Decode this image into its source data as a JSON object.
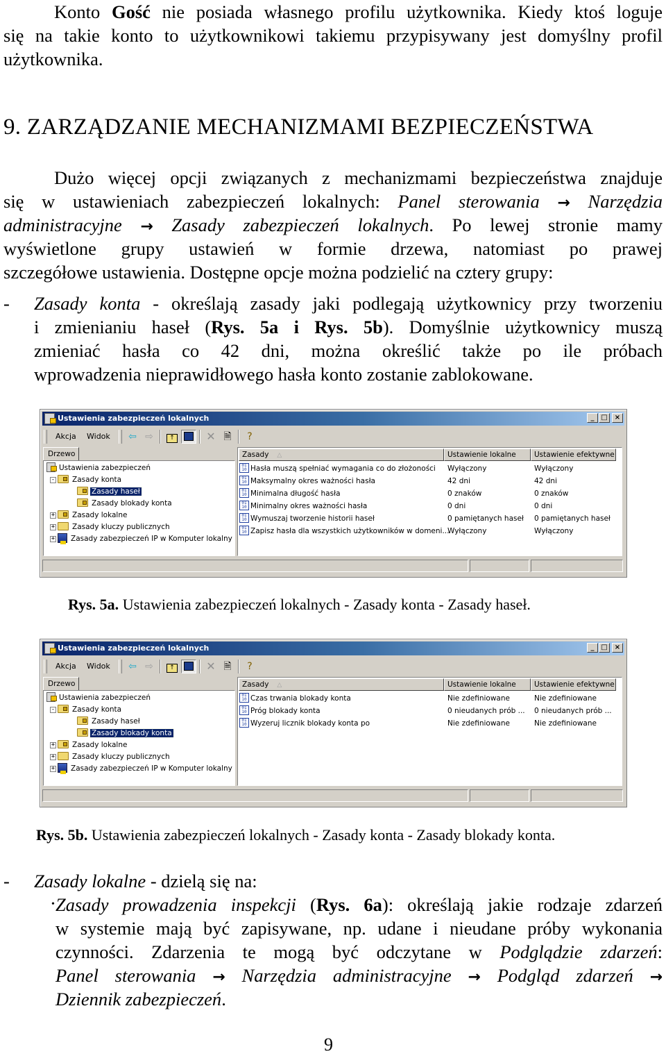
{
  "intro": {
    "line1_pre": "Konto ",
    "line1_bold": "Gość",
    "line1_post": " nie posiada własnego profilu użytkownika. Kiedy ktoś loguje",
    "line2": "się na takie konto to użytkownikowi takiemu przypisywany jest domyślny profil",
    "line3": "użytkownika."
  },
  "heading": "9. ZARZĄDZANIE MECHANIZMAMI BEZPIECZEŃSTWA",
  "para1": {
    "l1": "Dużo więcej opcji związanych z mechanizmami bezpieczeństwa znajduje",
    "l2_pre": "się w ustawieniach zabezpieczeń lokalnych: ",
    "l2_it1": "Panel sterowania",
    "l2_it2": "Narzędzia",
    "l3_it1": "administracyjne",
    "l3_it2": "Zasady zabezpieczeń lokalnych",
    "l3_post": ". Po lewej stronie mamy",
    "l4": "wyświetlone grupy ustawień w formie drzewa, natomiast po prawej",
    "l5": "szczegółowe ustawienia. Dostępne opcje można podzielić na cztery grupy:",
    "arrow": "→"
  },
  "bullet1": {
    "dash": "-",
    "l1_it": "Zasady konta",
    "l1_post": " - określają zasady jaki podlegają użytkownicy przy tworzeniu",
    "l2_pre": "i zmienianiu haseł (",
    "l2_b1": "Rys. 5a",
    "l2_mid": " i ",
    "l2_b2": "Rys. 5b",
    "l2_post": "). Domyślnie użytkownicy muszą",
    "l3": "zmieniać hasła co 42 dni, można określić także po ile próbach",
    "l4": "wprowadzenia nieprawidłowego hasła konto zostanie zablokowane."
  },
  "window": {
    "title": "Ustawienia zabezpieczeń lokalnych",
    "controls": {
      "minimize": "_",
      "maximize": "□",
      "close": "×"
    },
    "menu": {
      "action": "Akcja",
      "view": "Widok"
    },
    "toolbar_icons": [
      "back-arrow",
      "forward-arrow",
      "up-folder",
      "show-hide-tree",
      "delete",
      "export-list",
      "help"
    ],
    "tree_tab": "Drzewo",
    "tree": [
      {
        "label": "Ustawienia zabezpieczeń",
        "level": 0,
        "expander": "",
        "icon": "security-settings"
      },
      {
        "label": "Zasady konta",
        "level": 1,
        "expander": "-",
        "icon": "locked-folder"
      },
      {
        "label": "Zasady haseł",
        "level": 2,
        "expander": "",
        "icon": "locked-folder"
      },
      {
        "label": "Zasady blokady konta",
        "level": 2,
        "expander": "",
        "icon": "locked-folder"
      },
      {
        "label": "Zasady lokalne",
        "level": 1,
        "expander": "+",
        "icon": "locked-folder"
      },
      {
        "label": "Zasady kluczy publicznych",
        "level": 1,
        "expander": "+",
        "icon": "folder"
      },
      {
        "label": "Zasady zabezpieczeń IP w Komputer lokalny",
        "level": 1,
        "expander": "+",
        "icon": "computer-ip"
      }
    ],
    "columns": {
      "policy": "Zasady",
      "local": "Ustawienie lokalne",
      "effective": "Ustawienie efektywne"
    }
  },
  "fig5a": {
    "selected_tree_index": 2,
    "rows": [
      {
        "policy": "Hasła muszą spełniać wymagania co do złożoności",
        "local": "Wyłączony",
        "effective": "Wyłączony"
      },
      {
        "policy": "Maksymalny okres ważności hasła",
        "local": "42 dni",
        "effective": "42 dni"
      },
      {
        "policy": "Minimalna długość hasła",
        "local": "0 znaków",
        "effective": "0 znaków"
      },
      {
        "policy": "Minimalny okres ważności hasła",
        "local": "0 dni",
        "effective": "0 dni"
      },
      {
        "policy": "Wymuszaj tworzenie historii haseł",
        "local": "0 pamiętanych haseł",
        "effective": "0 pamiętanych haseł"
      },
      {
        "policy": "Zapisz hasła dla wszystkich użytkowników w domeni...",
        "local": "Wyłączony",
        "effective": "Wyłączony"
      }
    ],
    "caption_bold": "Rys. 5a.",
    "caption": " Ustawienia zabezpieczeń lokalnych - Zasady konta - Zasady haseł."
  },
  "fig5b": {
    "selected_tree_index": 3,
    "rows": [
      {
        "policy": "Czas trwania blokady konta",
        "local": "Nie zdefiniowane",
        "effective": "Nie zdefiniowane"
      },
      {
        "policy": "Próg blokady konta",
        "local": "0 nieudanych prób ...",
        "effective": "0 nieudanych prób ..."
      },
      {
        "policy": "Wyzeruj licznik blokady konta po",
        "local": "Nie zdefiniowane",
        "effective": "Nie zdefiniowane"
      }
    ],
    "caption_bold": "Rys. 5b.",
    "caption": " Ustawienia zabezpieczeń lokalnych - Zasady konta - Zasady blokady konta."
  },
  "bullet2": {
    "dash": "-",
    "l1_it": "Zasady lokalne",
    "l1_post": " - dzielą się na:",
    "sub_bullet": "•",
    "s1_it": "Zasady prowadzenia inspekcji",
    "s1_pre2": " (",
    "s1_b": "Rys. 6a",
    "s1_post": "): określają jakie rodzaje zdarzeń",
    "s2": "w systemie mają być zapisywane, np. udane i nieudane próby wykonania",
    "s3_pre": "czynności. Zdarzenia te mogą być odczytane w ",
    "s3_it": "Podglądzie zdarzeń",
    "s3_post": ":",
    "s4_it1": "Panel sterowania",
    "s4_it2": "Narzędzia administracyjne",
    "s4_it3": "Podgląd zdarzeń",
    "s5_it": "Dziennik zabezpieczeń",
    "s5_post": ".",
    "arrow": "→"
  },
  "page_number": "9"
}
